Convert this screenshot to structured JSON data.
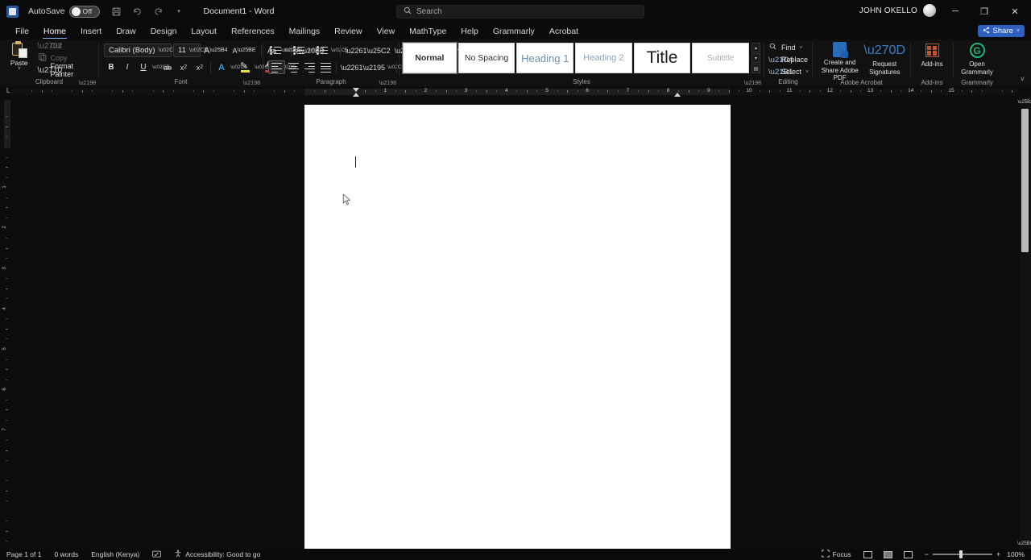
{
  "titlebar": {
    "app_icon": "word-logo-icon",
    "autosave_label": "AutoSave",
    "autosave_state": "Off",
    "quick_access": [
      {
        "name": "save",
        "glyph": "💾"
      },
      {
        "name": "undo",
        "glyph": "↶"
      },
      {
        "name": "redo",
        "glyph": "↻"
      },
      {
        "name": "customize-quick-access-toolbar",
        "glyph": "▾"
      }
    ],
    "document_title": "Document1  -  Word",
    "user_name": "JOHN OKELLO",
    "window_controls": {
      "minimize": "─",
      "restore": "❐",
      "close": "✕"
    }
  },
  "search": {
    "placeholder": "Search",
    "value": "",
    "icon": "search-icon"
  },
  "tabs": [
    {
      "label": "File",
      "active": false
    },
    {
      "label": "Home",
      "active": true
    },
    {
      "label": "Insert",
      "active": false
    },
    {
      "label": "Draw",
      "active": false
    },
    {
      "label": "Design",
      "active": false
    },
    {
      "label": "Layout",
      "active": false
    },
    {
      "label": "References",
      "active": false
    },
    {
      "label": "Mailings",
      "active": false
    },
    {
      "label": "Review",
      "active": false
    },
    {
      "label": "View",
      "active": false
    },
    {
      "label": "MathType",
      "active": false
    },
    {
      "label": "Help",
      "active": false
    },
    {
      "label": "Grammarly",
      "active": false
    },
    {
      "label": "Acrobat",
      "active": false
    }
  ],
  "share_button": {
    "label": "Share",
    "icon": "share-icon",
    "caret": "˅",
    "color": "#2f5fbf"
  },
  "ribbon": {
    "clipboard": {
      "group_label": "Clipboard",
      "paste_label": "Paste",
      "paste_caret": "˅",
      "cut_label": "Cut",
      "copy_label": "Copy",
      "format_painter_label": "Format Painter"
    },
    "font": {
      "group_label": "Font",
      "font_name": "Calibri (Body)",
      "font_size": "11",
      "grow_font": "A",
      "shrink_font": "A",
      "change_case": "Aa",
      "clear_formatting": "A",
      "bold": "B",
      "italic": "I",
      "underline": "U",
      "strikethrough": "ab",
      "subscript": "x",
      "superscript": "x",
      "text_effects": "A",
      "highlight": "highlight-color-icon",
      "font_color": "font-color-icon"
    },
    "paragraph": {
      "group_label": "Paragraph",
      "bullets": "bullets-icon",
      "numbering": "numbering-icon",
      "multilevel": "multilevel-list-icon",
      "decrease_indent": "decrease-indent-icon",
      "increase_indent": "increase-indent-icon",
      "sort": "sort-icon",
      "show_marks": "¶",
      "align_left": "align-left-icon",
      "align_center": "align-center-icon",
      "align_right": "align-right-icon",
      "justify": "justify-icon",
      "line_spacing": "line-spacing-icon",
      "shading": "shading-icon",
      "borders": "borders-icon"
    },
    "styles": {
      "group_label": "Styles",
      "items": [
        {
          "label": "Normal",
          "selected": true
        },
        {
          "label": "No Spacing",
          "selected": false
        },
        {
          "label": "Heading 1",
          "selected": false
        },
        {
          "label": "Heading 2",
          "selected": false
        },
        {
          "label": "Title",
          "selected": false
        },
        {
          "label": "Subtitle",
          "selected": false
        }
      ],
      "scroll_up": "▴",
      "scroll_down": "▾",
      "more": "▤"
    },
    "editing": {
      "group_label": "Editing",
      "find_label": "Find",
      "find_caret": "˅",
      "replace_label": "Replace",
      "select_label": "Select",
      "select_caret": "˅"
    },
    "acrobat": {
      "group_label": "Adobe Acrobat",
      "create_share_label": "Create and Share Adobe PDF",
      "request_sign_label": "Request Signatures"
    },
    "addins": {
      "group_label": "Add-ins",
      "button_label": "Add-ins"
    },
    "grammarly": {
      "group_label": "Grammarly",
      "button_label": "Open Grammarly",
      "accent": "#14b87b"
    },
    "collapse_icon": "˅"
  },
  "ruler": {
    "horizontal_numbers": [
      "1",
      "2",
      "3",
      "4",
      "5",
      "6",
      "7",
      "8",
      "9",
      "10",
      "11",
      "12",
      "13",
      "14",
      "15"
    ],
    "vertical_numbers": [
      "1",
      "2",
      "3",
      "4",
      "5",
      "6",
      "7"
    ],
    "tab_selector": "└",
    "left_indent_marker": "first-line-indent-marker",
    "right_indent_marker": "right-indent-marker"
  },
  "document": {
    "page_background": "#ffffff",
    "caret_visible": true,
    "content": ""
  },
  "statusbar": {
    "page_info": "Page 1 of 1",
    "word_count": "0 words",
    "language": "English (Kenya)",
    "proofing_icon": "proofing-icon",
    "accessibility_label": "Accessibility: Good to go",
    "accessibility_icon": "accessibility-icon",
    "focus_label": "Focus",
    "focus_icon": "focus-icon",
    "views": [
      {
        "name": "read-mode",
        "active": false
      },
      {
        "name": "print-layout",
        "active": true
      },
      {
        "name": "web-layout",
        "active": false
      }
    ],
    "zoom_out": "−",
    "zoom_in": "+",
    "zoom_value": "100%"
  }
}
